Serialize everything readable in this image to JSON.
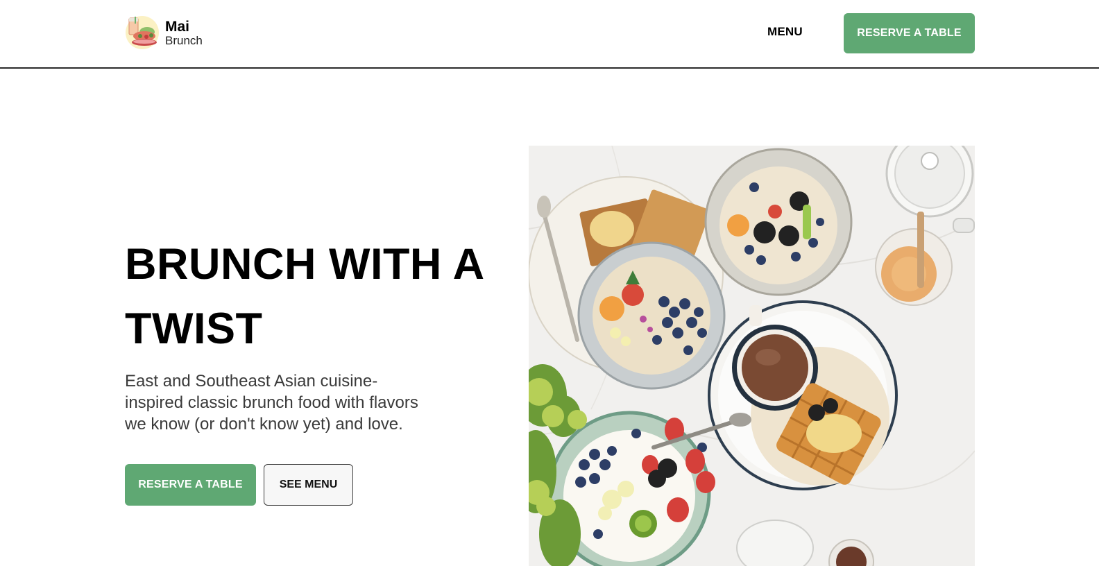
{
  "header": {
    "brand_name": "Mai",
    "brand_sub": "Brunch",
    "logo_icon": "brunch-logo-icon",
    "nav_menu_label": "MENU",
    "reserve_label": "RESERVE A TABLE"
  },
  "hero": {
    "title": "BRUNCH WITH A TWIST",
    "description": "East and Southeast Asian cuisine-inspired classic brunch food with flavors we know (or don't know yet) and love.",
    "reserve_label": "RESERVE A TABLE",
    "see_menu_label": "SEE MENU",
    "image_subject": "brunch-table-photo"
  },
  "colors": {
    "accent": "#5fa873",
    "text": "#111111",
    "muted_text": "#3a3a3a",
    "background": "#ffffff"
  }
}
